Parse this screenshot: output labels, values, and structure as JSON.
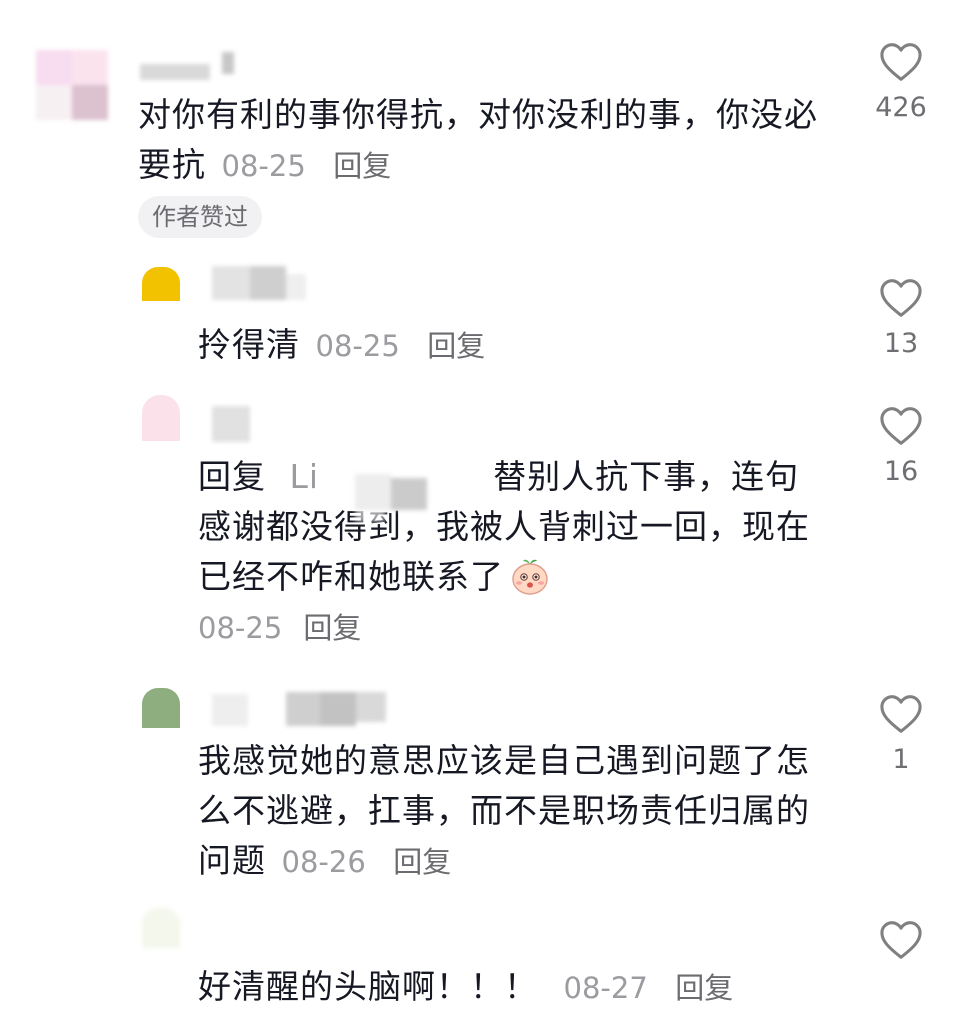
{
  "comments": [
    {
      "text": "对你有利的事你得抗，对你没利的事，你没必要抗",
      "date": "08-25",
      "reply_label": "回复",
      "badge": "作者赞过",
      "like_count": "426",
      "icon": "heart-outline-icon"
    },
    {
      "text": "拎得清",
      "date": "08-25",
      "reply_label": "回复",
      "like_count": "13",
      "icon": "heart-outline-icon"
    },
    {
      "reply_prefix": "回复",
      "reply_to": "Li",
      "text": "替别人抗下事，连句感谢都没得到，我被人背刺过一回，现在已经不咋和她联系了",
      "emoji": "blushing-face-emoji",
      "date": "08-25",
      "reply_label": "回复",
      "like_count": "16",
      "icon": "heart-outline-icon"
    },
    {
      "text": "我感觉她的意思应该是自己遇到问题了怎么不逃避，扛事，而不是职场责任归属的问题",
      "date": "08-26",
      "reply_label": "回复",
      "like_count": "1",
      "icon": "heart-outline-icon"
    },
    {
      "text": "好清醒的头脑啊！！！",
      "date": "08-27",
      "reply_label": "回复",
      "icon": "heart-outline-icon"
    }
  ],
  "colors": {
    "text": "#161823",
    "muted": "#9b9ba0",
    "reply": "#6b6b70",
    "badge_bg": "#f1f1f3"
  }
}
